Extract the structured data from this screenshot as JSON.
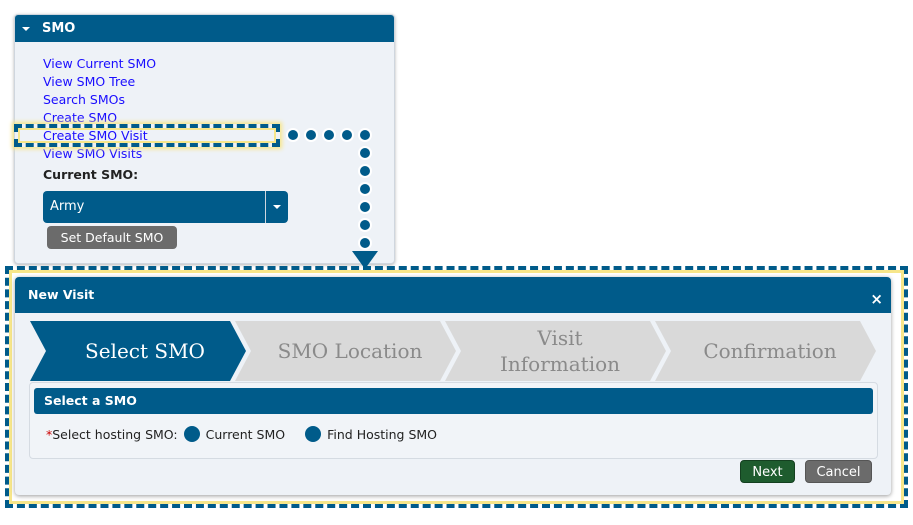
{
  "sidebar": {
    "title": "SMO",
    "links": [
      "View Current SMO",
      "View SMO Tree",
      "Search SMOs",
      "Create SMO",
      "Create SMO Visit",
      "View SMO Visits"
    ],
    "current_label": "Current SMO:",
    "current_value": "Army",
    "set_default": "Set Default SMO"
  },
  "dialog": {
    "title": "New Visit",
    "close": "×",
    "steps": [
      "Select SMO",
      "SMO Location",
      "Visit\nInformation",
      "Confirmation"
    ],
    "active_step": 0,
    "section_title": "Select a SMO",
    "required_mark": "*",
    "field_label": "Select hosting SMO:",
    "options": [
      "Current SMO",
      "Find Hosting SMO"
    ],
    "next": "Next",
    "cancel": "Cancel"
  },
  "colors": {
    "primary": "#005b8a",
    "highlight": "#f7e68a",
    "next": "#1e5c2e",
    "cancel": "#6b6b6b"
  }
}
